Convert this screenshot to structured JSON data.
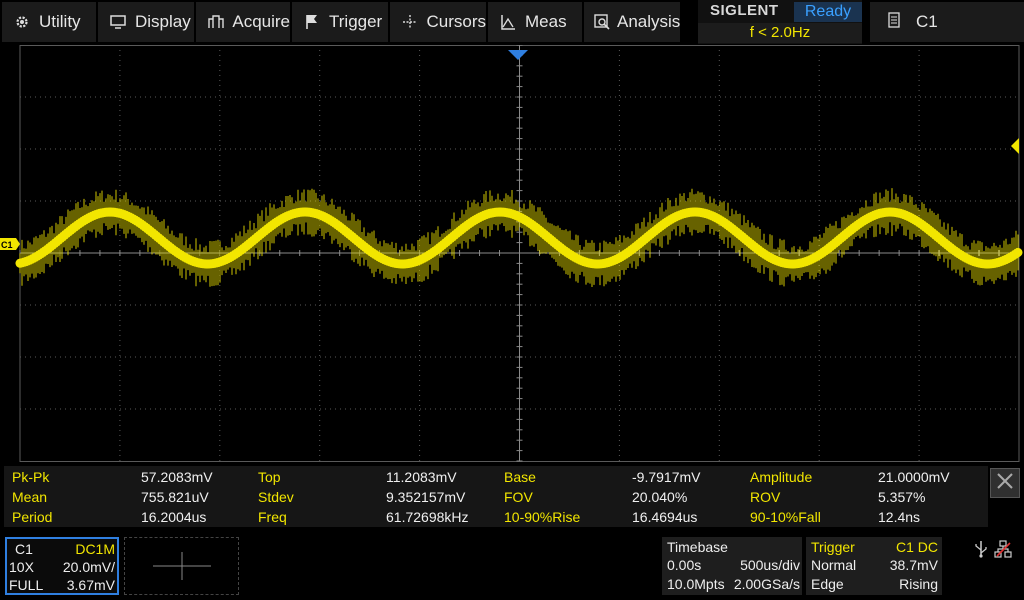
{
  "menu": [
    {
      "label": "Utility",
      "icon": "gear-icon"
    },
    {
      "label": "Display",
      "icon": "monitor-icon"
    },
    {
      "label": "Acquire",
      "icon": "acquire-icon"
    },
    {
      "label": "Trigger",
      "icon": "flag-icon"
    },
    {
      "label": "Cursors",
      "icon": "cursor-cross-icon"
    },
    {
      "label": "Meas",
      "icon": "measure-icon"
    },
    {
      "label": "Analysis",
      "icon": "analysis-icon"
    }
  ],
  "brand": {
    "logo": "SIGLENT",
    "status": "Ready",
    "freq": "f < 2.0Hz"
  },
  "channel_select": {
    "label": "C1",
    "icon": "menu-list-icon"
  },
  "waveform": {
    "channel_marker": "C1",
    "trace_color": "#f2e600",
    "grid_color": "#5a5a5a"
  },
  "measurements": [
    [
      {
        "name": "Pk-Pk",
        "value": "57.2083mV"
      },
      {
        "name": "Top",
        "value": "11.2083mV"
      },
      {
        "name": "Base",
        "value": "-9.7917mV"
      },
      {
        "name": "Amplitude",
        "value": "21.0000mV"
      }
    ],
    [
      {
        "name": "Mean",
        "value": "755.821uV"
      },
      {
        "name": "Stdev",
        "value": "9.352157mV"
      },
      {
        "name": "FOV",
        "value": "20.040%"
      },
      {
        "name": "ROV",
        "value": "5.357%"
      }
    ],
    [
      {
        "name": "Period",
        "value": "16.2004us"
      },
      {
        "name": "Freq",
        "value": "61.72698kHz"
      },
      {
        "name": "10-90%Rise",
        "value": "16.4694us"
      },
      {
        "name": "90-10%Fall",
        "value": "12.4ns"
      }
    ]
  ],
  "channel1": {
    "name": "C1",
    "coupling": "DC1M",
    "probe": "10X",
    "scale": "20.0mV/",
    "bandwidth": "FULL",
    "offset": "3.67mV"
  },
  "timebase": {
    "title": "Timebase",
    "delay": "0.00s",
    "scale": "500us/div",
    "memory": "10.0Mpts",
    "sample_rate": "2.00GSa/s"
  },
  "trigger": {
    "title": "Trigger",
    "source": "C1 DC",
    "mode": "Normal",
    "level": "38.7mV",
    "type": "Edge",
    "slope": "Rising"
  }
}
